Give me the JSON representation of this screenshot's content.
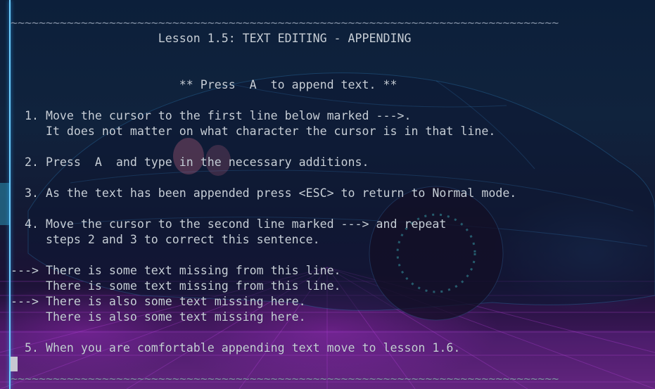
{
  "terminal": {
    "lines": [
      "~~~~~~~~~~~~~~~~~~~~~~~~~~~~~~~~~~~~~~~~~~~~~~~~~~~~~~~~~~~~~~~~~~~~~~~~~~~~~~",
      "                     Lesson 1.5: TEXT EDITING - APPENDING",
      "",
      "",
      "                        ** Press  A  to append text. **",
      "",
      "  1. Move the cursor to the first line below marked --->.",
      "     It does not matter on what character the cursor is in that line.",
      "",
      "  2. Press  A  and type in the necessary additions.",
      "",
      "  3. As the text has been appended press <ESC> to return to Normal mode.",
      "",
      "  4. Move the cursor to the second line marked ---> and repeat",
      "     steps 2 and 3 to correct this sentence.",
      "",
      "---> There is some text missing from this line.",
      "     There is some text missing from this line.",
      "---> There is also some text missing here.",
      "     There is also some text missing here.",
      "",
      "  5. When you are comfortable appending text move to lesson 1.6.",
      "",
      "~~~~~~~~~~~~~~~~~~~~~~~~~~~~~~~~~~~~~~~~~~~~~~~~~~~~~~~~~~~~~~~~~~~~~~~~~~~~~~"
    ]
  },
  "colors": {
    "text": "#c7cfd9",
    "tilde": "#7f8fa6",
    "cursor": "#c7c7d2",
    "accent_bar": "#6fd0ff"
  }
}
